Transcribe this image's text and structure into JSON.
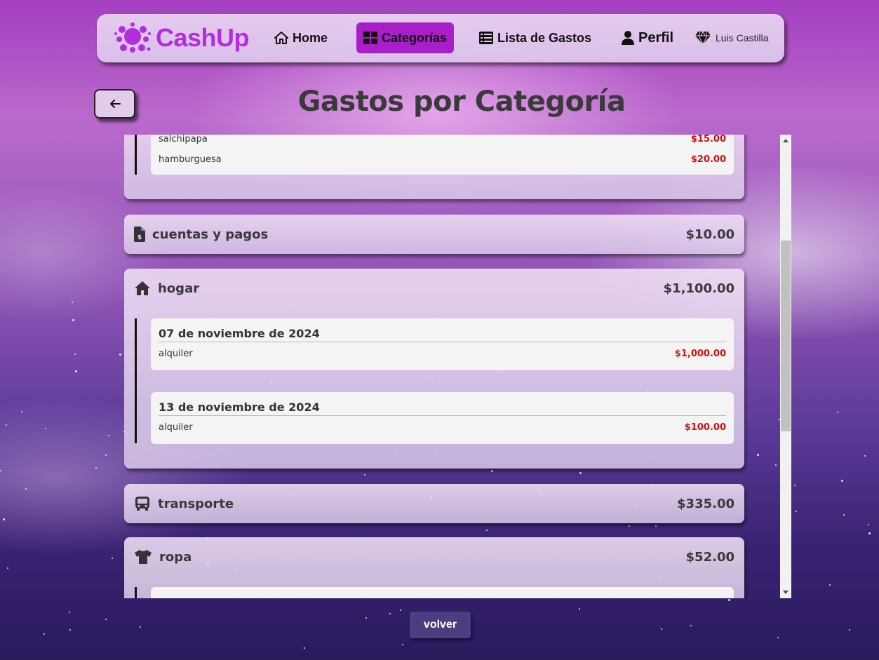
{
  "brand": {
    "name": "CashUp",
    "accent": "#b32de0"
  },
  "nav": {
    "home": "Home",
    "categories": "Categorías",
    "expense_list": "Lista de Gastos",
    "profile": "Perfil",
    "user": "Luis Castilla",
    "active_color": "#a81ec9"
  },
  "header": {
    "title": "Gastos por Categoría",
    "back_icon": "arrow-left-icon"
  },
  "categories": [
    {
      "name": "",
      "total": "",
      "icon": "",
      "days": [
        {
          "date": "",
          "expenses": [
            {
              "name": "salchipapa",
              "amount": "$15.00"
            },
            {
              "name": "hamburguesa",
              "amount": "$20.00"
            }
          ]
        }
      ]
    },
    {
      "name": "cuentas y pagos",
      "total": "$10.00",
      "icon": "file-invoice-dollar-icon",
      "days": []
    },
    {
      "name": "hogar",
      "total": "$1,100.00",
      "icon": "house-icon",
      "days": [
        {
          "date": "07 de noviembre de 2024",
          "expenses": [
            {
              "name": "alquiler",
              "amount": "$1,000.00"
            }
          ]
        },
        {
          "date": "13 de noviembre de 2024",
          "expenses": [
            {
              "name": "alquiler",
              "amount": "$100.00"
            }
          ]
        }
      ]
    },
    {
      "name": "transporte",
      "total": "$335.00",
      "icon": "bus-icon",
      "days": []
    },
    {
      "name": "ropa",
      "total": "$52.00",
      "icon": "shirt-icon",
      "days": []
    }
  ],
  "footer": {
    "back_button": "volver"
  },
  "colors": {
    "amount": "#d01010",
    "button": "#4b3d80"
  }
}
